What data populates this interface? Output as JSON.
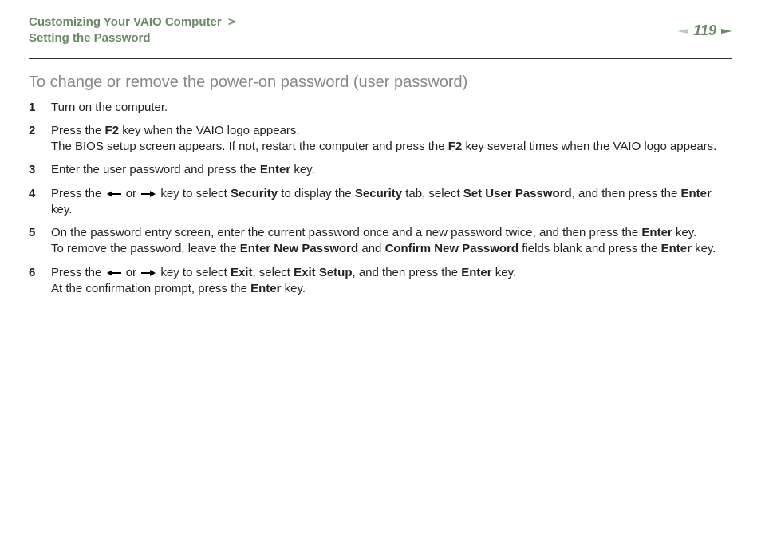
{
  "header": {
    "breadcrumb_line1": "Customizing Your VAIO Computer",
    "breadcrumb_chevron": ">",
    "breadcrumb_line2": "Setting the Password",
    "page_number": "119"
  },
  "section_title": "To change or remove the power-on password (user password)",
  "steps": {
    "s1": "Turn on the computer.",
    "s2_a": "Press the ",
    "s2_b": " key when the VAIO logo appears.",
    "s2_c": "The BIOS setup screen appears. If not, restart the computer and press the ",
    "s2_d": " key several times when the VAIO logo appears.",
    "s3_a": "Enter the user password and press the ",
    "s3_b": " key.",
    "s4_a": "Press the ",
    "s4_b": " or ",
    "s4_c": " key to select ",
    "s4_d": " to display the ",
    "s4_e": " tab, select ",
    "s4_f": ", and then press the ",
    "s4_g": " key.",
    "s5_a": "On the password entry screen, enter the current password once and a new password twice, and then press the ",
    "s5_b": " key.",
    "s5_c": "To remove the password, leave the ",
    "s5_d": " and ",
    "s5_e": " fields blank and press the ",
    "s5_f": " key.",
    "s6_a": "Press the ",
    "s6_b": " or ",
    "s6_c": " key to select ",
    "s6_d": ", select ",
    "s6_e": ", and then press the ",
    "s6_f": " key.",
    "s6_g": "At the confirmation prompt, press the ",
    "s6_h": " key."
  },
  "bold": {
    "F2": "F2",
    "Enter": "Enter",
    "Security": "Security",
    "SetUserPassword": "Set User Password",
    "EnterNewPassword": "Enter New Password",
    "ConfirmNewPassword": "Confirm New Password",
    "Exit": "Exit",
    "ExitSetup": "Exit Setup"
  }
}
